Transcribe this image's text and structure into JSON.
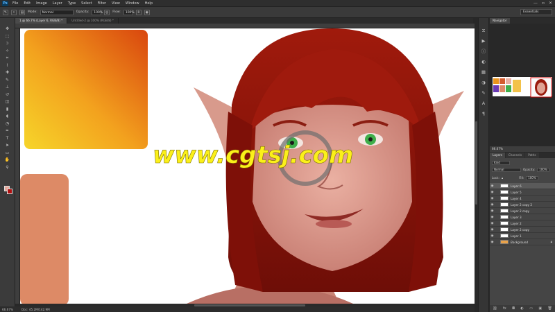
{
  "app": {
    "logo": "Ps"
  },
  "menu": [
    "File",
    "Edit",
    "Image",
    "Layer",
    "Type",
    "Select",
    "Filter",
    "View",
    "Window",
    "Help"
  ],
  "window_controls": [
    "—",
    "▫",
    "✕"
  ],
  "options": {
    "mode_label": "Mode:",
    "mode_value": "Normal",
    "opacity_label": "Opacity:",
    "opacity_value": "100%",
    "flow_label": "Flow:",
    "flow_value": "100%",
    "workspace": "Essentials"
  },
  "tabs": [
    {
      "label": "1 @ 66.7% (Layer 6, RGB/8) *",
      "active": true
    },
    {
      "label": "Untitled-2 @ 100% (RGB/8) *",
      "active": false
    }
  ],
  "status": {
    "zoom": "66.67%",
    "doc": "Doc: 45.2M/142.9M"
  },
  "navigator": {
    "tab": "Navigator",
    "zoom": "66.67%"
  },
  "layers_panel": {
    "tabs": [
      "Layers",
      "Channels",
      "Paths"
    ],
    "kind": "Kind",
    "blend_mode": "Normal",
    "opacity_label": "Opacity:",
    "opacity_value": "100%",
    "lock_label": "Lock:",
    "fill_label": "Fill:",
    "fill_value": "100%",
    "layers": [
      {
        "name": "Layer 6",
        "selected": true
      },
      {
        "name": "Layer 5",
        "selected": false
      },
      {
        "name": "Layer 4",
        "selected": false
      },
      {
        "name": "Layer 2 copy 2",
        "selected": false
      },
      {
        "name": "Layer 2 copy",
        "selected": false
      },
      {
        "name": "Layer 3",
        "selected": false
      },
      {
        "name": "Layer 2",
        "selected": false
      },
      {
        "name": "Layer 2 copy",
        "selected": false
      },
      {
        "name": "Layer 1",
        "selected": false
      },
      {
        "name": "Background",
        "selected": false
      }
    ]
  },
  "watermark": "www.cgtsj.com",
  "colors": {
    "foreground": "#e7a89a",
    "background": "#b01010",
    "hair": "#9b1c0e",
    "skin": "#e0a394",
    "eye": "#3fae4a"
  }
}
